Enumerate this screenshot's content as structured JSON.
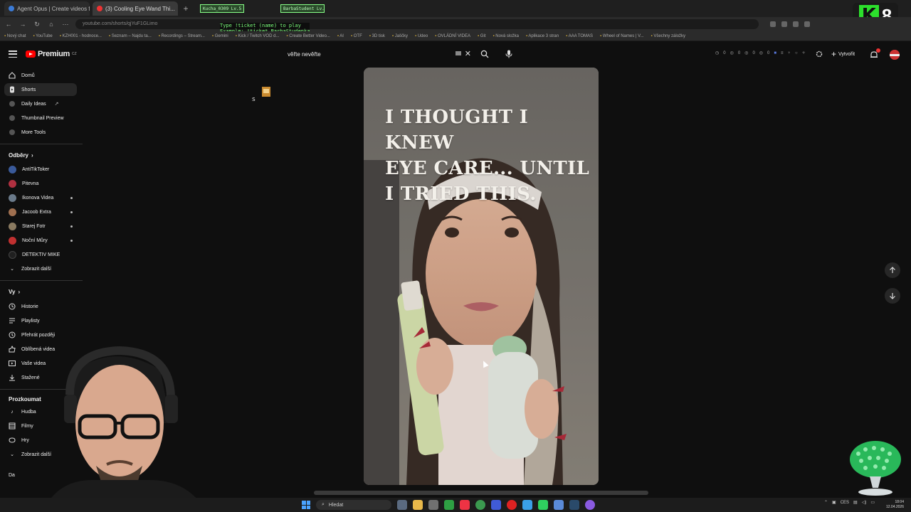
{
  "browser": {
    "tabs": [
      {
        "label": "Agent Opus | Create videos fro",
        "active": false
      },
      {
        "label": "(3) Cooling Eye Wand Thi...",
        "active": true
      }
    ],
    "url": "youtube.com/shorts/qjYuF1GLimo",
    "overlay_badges": [
      "Kucha_0309 Lv.5",
      "BarbaStudent Lv.4"
    ],
    "chat_note_line1": "Type !ticket (name) to play",
    "chat_note_line2": "Example: !ticket BarbaStudenka",
    "bookmarks": [
      "Nový chat",
      "YouTube",
      "KZH001 - hodnoce...",
      "Seznam – Najdu ta...",
      "Recordings – Stream...",
      "Gemini",
      "Kick / Twitch VOD d...",
      "Create Better Video...",
      "AI",
      "OTF",
      "3D tisk",
      "Jaščky",
      "Udeo",
      "OVLÁDNÍ VIDEA",
      "Git",
      "Nová složka",
      "Aplikace 3 stran",
      "AAA TOMAS",
      "Wheel of Names | V...",
      "Všechny záložky"
    ],
    "stream_badge_letter": "K",
    "stream_badge_number": "8"
  },
  "header": {
    "logo_text": "Premium",
    "logo_sup": "CZ",
    "search_value": "věřte nevěřte",
    "create_label": "Vytvořit",
    "stats": [
      "0",
      "0",
      "0",
      "0"
    ]
  },
  "sidebar": {
    "main": [
      {
        "label": "Domů",
        "icon": "home-icon"
      },
      {
        "label": "Shorts",
        "icon": "shorts-icon",
        "active": true
      },
      {
        "label": "Daily Ideas",
        "icon": "ideas-icon",
        "external": true
      },
      {
        "label": "Thumbnail Preview",
        "icon": "thumbnail-icon"
      },
      {
        "label": "More Tools",
        "icon": "tools-icon"
      }
    ],
    "subscriptions_heading": "Odběry",
    "subscriptions": [
      {
        "label": "AntiTikToker",
        "color": "#3a5a9a",
        "live": false
      },
      {
        "label": "Pitevna",
        "color": "#b03040",
        "live": false
      },
      {
        "label": "Ikonova Videa",
        "color": "#6a7a8a",
        "live": true
      },
      {
        "label": "Jacoob Extra",
        "color": "#a07050",
        "live": true
      },
      {
        "label": "Starej Fotr",
        "color": "#8a7a60",
        "live": true
      },
      {
        "label": "Noční Můry",
        "color": "#c03030",
        "live": true
      },
      {
        "label": "DETEKTIV MIKE",
        "color": "#202020",
        "live": false
      }
    ],
    "show_more": "Zobrazit další",
    "you_heading": "Vy",
    "you_items": [
      {
        "label": "Historie",
        "icon": "history-icon"
      },
      {
        "label": "Playlisty",
        "icon": "playlist-icon"
      },
      {
        "label": "Přehrát později",
        "icon": "watch-later-icon"
      },
      {
        "label": "Oblíbená videa",
        "icon": "like-icon"
      },
      {
        "label": "Vaše videa",
        "icon": "your-videos-icon"
      },
      {
        "label": "Stažené",
        "icon": "download-icon"
      }
    ],
    "explore_heading": "Prozkoumat",
    "explore_items": [
      {
        "label": "Hudba",
        "icon": "music-icon"
      },
      {
        "label": "Filmy",
        "icon": "film-icon"
      },
      {
        "label": "Hry",
        "icon": "gaming-icon"
      }
    ],
    "explore_more": "Zobrazit další",
    "cut_label": "Da"
  },
  "short": {
    "caption_line1": "I THOUGHT I KNEW",
    "caption_line2": "EYE CARE... UNTIL",
    "caption_line3": "I TRIED THIS."
  },
  "taskbar": {
    "search_placeholder": "Hledat",
    "language": "CES",
    "time": "18:04",
    "date": "12.04.2026"
  },
  "colors": {
    "background": "#0f0f0f",
    "accent": "#ff0000",
    "sidebar_active": "#272727"
  }
}
